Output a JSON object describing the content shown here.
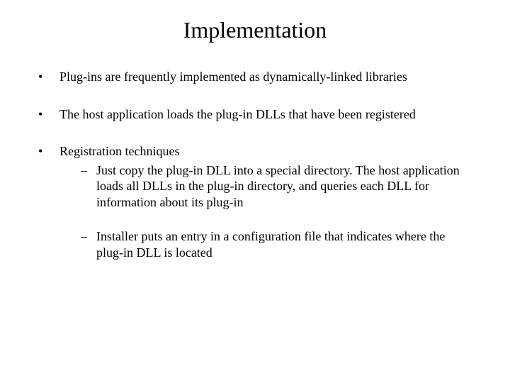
{
  "title": "Implementation",
  "bullets": {
    "b1": "Plug-ins are frequently implemented as dynamically-linked libraries",
    "b2": "The host application loads the plug-in DLLs that have been registered",
    "b3": "Registration techniques",
    "b3_sub": {
      "s1": "Just copy the plug-in DLL into a special directory.  The host application loads all DLLs in the plug-in directory, and queries each DLL for information about its plug-in",
      "s2": "Installer puts an entry in a configuration file that indicates where the plug-in DLL is located"
    }
  }
}
